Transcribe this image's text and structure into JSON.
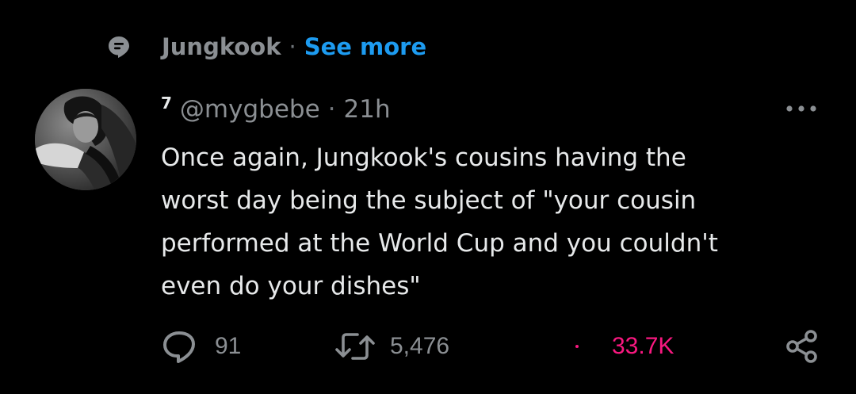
{
  "topic": {
    "icon": "topic-icon",
    "name": "Jungkook",
    "separator": "·",
    "see_more_label": "See more"
  },
  "tweet": {
    "avatar_icon": "avatar",
    "display_name": "7",
    "handle": "@mygbebe",
    "separator": "·",
    "time": "21h",
    "more_icon": "more-horizontal-icon",
    "text": "Once again, Jungkook's cousins having the\nworst day being the subject of \"your cousin\nperformed at the World Cup and you couldn't\neven do your dishes\""
  },
  "actions": {
    "reply_count": "91",
    "retweet_count": "5,476",
    "like_count": "33.7K",
    "reply_icon": "reply-icon",
    "retweet_icon": "retweet-icon",
    "share_icon": "share-icon"
  },
  "colors": {
    "background": "#000000",
    "text": "#e7e9ea",
    "secondary": "#8b8f93",
    "link": "#1d9bf0",
    "like": "#f91880"
  }
}
